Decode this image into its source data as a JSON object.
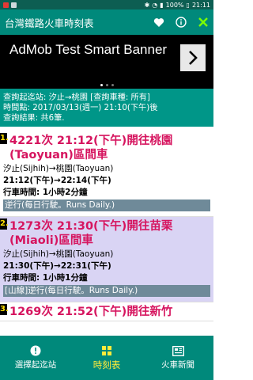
{
  "status": {
    "time": "21:11",
    "battery": "100%"
  },
  "appbar": {
    "title": "台灣鐵路火車時刻表",
    "icons": [
      "heart-icon",
      "info-icon",
      "close-icon"
    ]
  },
  "banner": {
    "text": "AdMob Test Smart Banner"
  },
  "query": {
    "line1": "查詢起迄站: 汐止→桃園 [查詢車種: 所有]",
    "line2": "時間點: 2017/03/13(週一) 21:10(下午)後",
    "line3": "查詢結果: 共6筆."
  },
  "trains": [
    {
      "num": "1.",
      "title": "4221次 21:12(下午)開往桃園(Taoyuan)區間車",
      "route": "汐止(Sijhih)→桃園(Taoyuan)",
      "times": "21:12(下午)→22:14(下午)",
      "duration": "行車時間: 1小時2分鐘",
      "note": "逆行(每日行駛。Runs Daily.)"
    },
    {
      "num": "2.",
      "title": "1273次 21:30(下午)開往苗栗(Miaoli)區間車",
      "route": "汐止(Sijhih)→桃園(Taoyuan)",
      "times": "21:30(下午)→22:31(下午)",
      "duration": "行車時間: 1小時1分鐘",
      "note": "[山線]逆行(每日行駛。Runs Daily.)"
    },
    {
      "num": "3.",
      "title": "1269次 21:52(下午)開往新竹",
      "route": "",
      "times": "",
      "duration": "",
      "note": ""
    }
  ],
  "nav": {
    "tabs": [
      {
        "label": "選擇起迄站",
        "icon": "alert-circle-icon"
      },
      {
        "label": "時刻表",
        "icon": "grid-icon"
      },
      {
        "label": "火車新聞",
        "icon": "news-icon"
      }
    ]
  },
  "colors": {
    "statusbar": "#0d5e52",
    "appbar": "#00897b",
    "query": "#009688",
    "train_title": "#d6155f",
    "active_tab": "#ffeb3b"
  }
}
